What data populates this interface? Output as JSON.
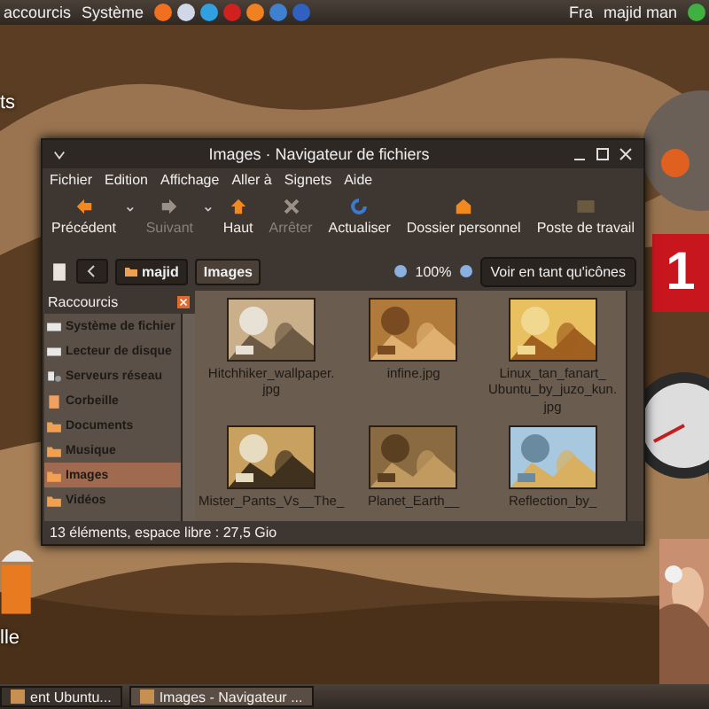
{
  "top_panel": {
    "menus": [
      "accourcis",
      "Système"
    ],
    "user": {
      "layout": "Fra",
      "name": "majid man"
    }
  },
  "desktop": {
    "icon_labels": [
      "ts",
      "lle"
    ],
    "calendar": {
      "day": "1"
    }
  },
  "window": {
    "title": "Images · Navigateur de fichiers",
    "menu": [
      "Fichier",
      "Edition",
      "Affichage",
      "Aller à",
      "Signets",
      "Aide"
    ],
    "toolbar": [
      {
        "label": "Précédent",
        "kind": "back",
        "disabled": false,
        "dropdown": true
      },
      {
        "label": "Suivant",
        "kind": "forward",
        "disabled": true,
        "dropdown": true
      },
      {
        "label": "Haut",
        "kind": "up",
        "disabled": false,
        "dropdown": false
      },
      {
        "label": "Arrêter",
        "kind": "stop",
        "disabled": true,
        "dropdown": false
      },
      {
        "label": "Actualiser",
        "kind": "reload",
        "disabled": false,
        "dropdown": false
      },
      {
        "label": "Dossier personnel",
        "kind": "home",
        "disabled": false,
        "dropdown": false
      },
      {
        "label": "Poste de travail",
        "kind": "computer",
        "disabled": false,
        "dropdown": false
      }
    ],
    "path": [
      {
        "label": "majid",
        "selected": false
      },
      {
        "label": "Images",
        "selected": true
      }
    ],
    "zoom": "100%",
    "view": "Voir en tant qu'icônes",
    "sidebar": {
      "title": "Raccourcis",
      "items": [
        {
          "label": "Système de fichier",
          "kind": "drive",
          "selected": false
        },
        {
          "label": "Lecteur de disque",
          "kind": "drive",
          "selected": false
        },
        {
          "label": "Serveurs réseau",
          "kind": "network",
          "selected": false
        },
        {
          "label": "Corbeille",
          "kind": "trash",
          "selected": false
        },
        {
          "label": "Documents",
          "kind": "folder",
          "selected": false
        },
        {
          "label": "Musique",
          "kind": "folder",
          "selected": false
        },
        {
          "label": "Images",
          "kind": "folder",
          "selected": true
        },
        {
          "label": "Vidéos",
          "kind": "folder",
          "selected": false
        }
      ]
    },
    "files": [
      {
        "name": "Hitchhiker_wallpaper.\njpg",
        "kind": "picture"
      },
      {
        "name": "infine.jpg",
        "kind": "picture"
      },
      {
        "name": "Linux_tan_fanart_\nUbuntu_by_juzo_kun.\njpg",
        "kind": "picture"
      },
      {
        "name": "Mister_Pants_Vs__The_",
        "kind": "picture"
      },
      {
        "name": "Planet_Earth__",
        "kind": "picture"
      },
      {
        "name": "Reflection_by_",
        "kind": "picture"
      }
    ],
    "status": "13 éléments, espace libre : 27,5 Gio"
  },
  "taskbar": [
    {
      "label": "ent Ubuntu...",
      "selected": false
    },
    {
      "label": "Images - Navigateur ...",
      "selected": true
    }
  ]
}
